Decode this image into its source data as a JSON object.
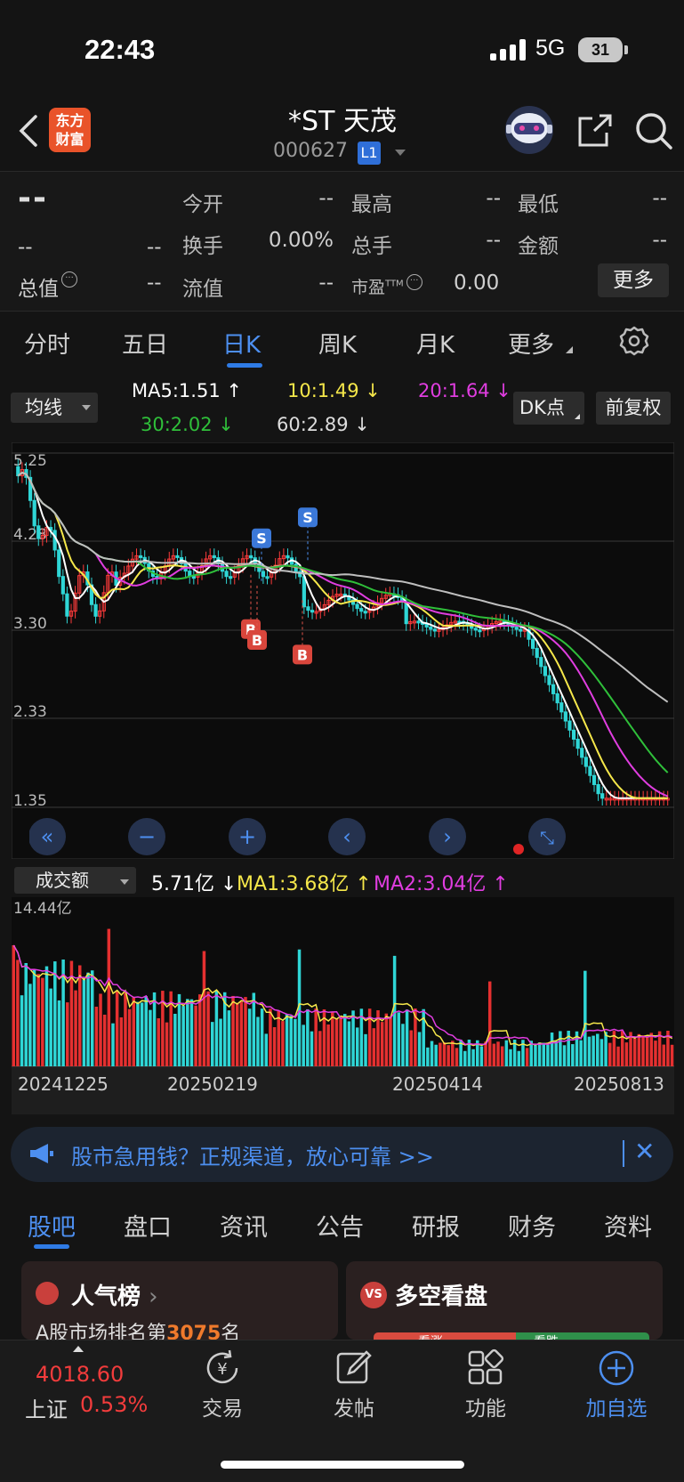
{
  "status": {
    "time": "22:43",
    "network": "5G",
    "battery": "31"
  },
  "header": {
    "logo": "东方财富",
    "stock_name": "*ST 天茂",
    "stock_code": "000627",
    "level_badge": "L1"
  },
  "quote": {
    "price": "--",
    "change": "--",
    "change_pct": "--",
    "rows": [
      [
        {
          "label": "今开",
          "value": "--"
        },
        {
          "label": "最高",
          "value": "--"
        },
        {
          "label": "最低",
          "value": "--"
        }
      ],
      [
        {
          "label": "换手",
          "value": "0.00%"
        },
        {
          "label": "总手",
          "value": "--"
        },
        {
          "label": "金额",
          "value": "--"
        }
      ],
      [
        {
          "label": "流值",
          "value": "--"
        },
        {
          "label": "市盈",
          "value": "0.00"
        }
      ]
    ],
    "total_value_label": "总值",
    "total_value": "--",
    "pe_superscript": "TTM",
    "more_label": "更多"
  },
  "period_tabs": [
    "分时",
    "五日",
    "日K",
    "周K",
    "月K",
    "更多"
  ],
  "active_period": "日K",
  "ma_bar": {
    "select_label": "均线",
    "ma5": "MA5:1.51 ↑",
    "ma10": "10:1.49 ↓",
    "ma20": "20:1.64 ↓",
    "ma30": "30:2.02 ↓",
    "ma60": "60:2.89 ↓",
    "dk_label": "DK点",
    "adjust_label": "前复权",
    "colors": {
      "ma5": "#ffffff",
      "ma10": "#f5e74a",
      "ma20": "#e03de0",
      "ma30": "#2fbf3a",
      "ma60": "#bfbfbf"
    }
  },
  "chart_data": {
    "type": "candlestick",
    "y_ticks": [
      "5.25",
      "4.28",
      "3.30",
      "2.33",
      "1.35"
    ],
    "ylim": [
      1.35,
      5.25
    ],
    "dates": [
      "20241225",
      "20250219",
      "20250414",
      "20250813"
    ],
    "trade_marks": [
      {
        "label": "S",
        "value": 4.42
      },
      {
        "label": "S",
        "value": 4.65
      },
      {
        "label": "B",
        "value": 3.42
      },
      {
        "label": "B",
        "value": 3.3
      },
      {
        "label": "B",
        "value": 3.14
      }
    ]
  },
  "controls": [
    "«",
    "−",
    "+",
    "‹",
    "›"
  ],
  "volume": {
    "select_label": "成交额",
    "current": "5.71亿 ↓",
    "ma1": "MA1:3.68亿 ↑",
    "ma2": "MA2:3.04亿 ↑",
    "max_label": "14.44亿"
  },
  "banner": {
    "text": "股市急用钱？正规渠道，放心可靠 >>"
  },
  "bottom_tabs": [
    "股吧",
    "盘口",
    "资讯",
    "公告",
    "研报",
    "财务",
    "资料"
  ],
  "active_bottom_tab": "股吧",
  "cards": {
    "popularity_title": "人气榜",
    "popularity_sub_prefix": "A股市场排名第",
    "popularity_rank": "3075",
    "popularity_sub_suffix": "名",
    "bullbear_title": "多空看盘",
    "bullbear_left": "看涨",
    "bullbear_right": "看跌"
  },
  "index": {
    "value": "4018.60",
    "name": "上证",
    "pct": "0.53%"
  },
  "bottom_nav": [
    "交易",
    "发帖",
    "功能",
    "加自选"
  ]
}
